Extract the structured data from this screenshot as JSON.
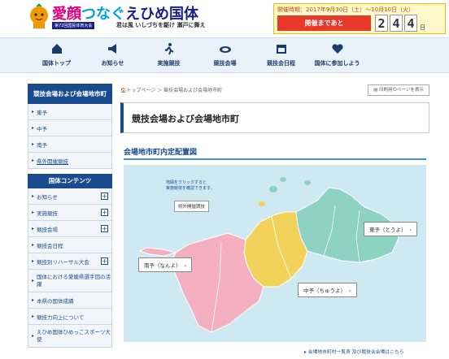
{
  "header": {
    "logo_part1": "愛顔",
    "logo_part2": "つなぐ",
    "logo_part3": "えひめ国体",
    "logo_sub": "第72回国民体育大会",
    "slogan": "君は風 いしづちを駆け 瀬戸に舞え",
    "event_period": "開催時期：2017年9月30日（土）～10月10日（火）",
    "countdown_label": "開催まであと",
    "countdown_digits": [
      "2",
      "4",
      "4"
    ],
    "countdown_unit": "日"
  },
  "nav": [
    {
      "label": "国体トップ",
      "icon": "house-icon"
    },
    {
      "label": "お知らせ",
      "icon": "megaphone-icon"
    },
    {
      "label": "実施競技",
      "icon": "runner-icon"
    },
    {
      "label": "競技会場",
      "icon": "stadium-icon"
    },
    {
      "label": "競技会日程",
      "icon": "calendar-icon"
    },
    {
      "label": "国体に参加しよう",
      "icon": "heart-icon"
    }
  ],
  "sidebar": {
    "heading": "競技会場および会場地市町",
    "regions": [
      "東予",
      "中予",
      "南予",
      "県外開催競技"
    ],
    "section_heading": "国体コンテンツ",
    "contents": [
      {
        "label": "お知らせ",
        "expand": true
      },
      {
        "label": "実施競技",
        "expand": true
      },
      {
        "label": "競技会場",
        "expand": true
      },
      {
        "label": "競技会日程",
        "expand": false
      },
      {
        "label": "競技別リハーサル大会",
        "expand": true
      },
      {
        "label": "国体における愛媛県選手団の活躍",
        "expand": false
      },
      {
        "label": "本県の国体成績",
        "expand": false
      },
      {
        "label": "競技力向上について",
        "expand": false
      },
      {
        "label": "えひめ国体ひめっこスポーツ大使",
        "expand": false
      }
    ]
  },
  "main": {
    "breadcrumb": "トップページ ＞ 競技会場および会場地市町",
    "print_label": "印刷用のページを表示",
    "title": "競技会場および会場地市町",
    "section_title": "会場地市町内定配置図",
    "map_hint_lines": [
      "地図をクリックすると",
      "実施競技を確認できます。"
    ],
    "outside_tag": "県外開催競技",
    "regions": {
      "toyo": "東予（とうよ）",
      "chuyo": "中予（ちゅうよ）",
      "nanyo": "南予（なんよ）"
    },
    "footer_link": "会場地市町村一覧表 及び競技会会場はこちら"
  },
  "colors": {
    "navy": "#1a4b8f",
    "toyo": "#8ed2c4",
    "chuyo": "#f2d25a",
    "nanyo": "#f4b0c0",
    "sea": "#cfe9f2"
  }
}
